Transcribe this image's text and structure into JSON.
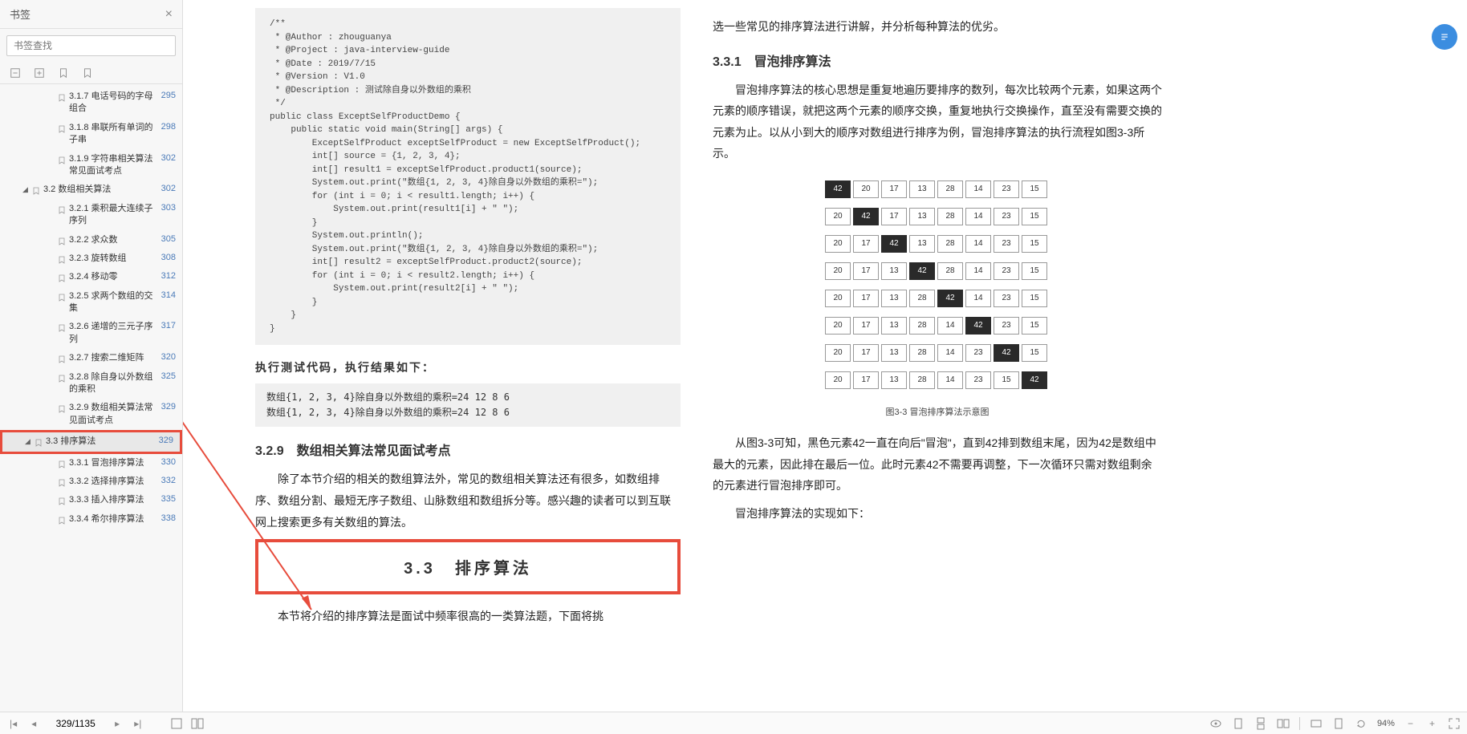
{
  "sidebar": {
    "title": "书签",
    "search_placeholder": "书签查找",
    "items": [
      {
        "label": "3.1.7  电话号码的字母组合",
        "page": "295",
        "indent": 2
      },
      {
        "label": "3.1.8  串联所有单词的子串",
        "page": "298",
        "indent": 2
      },
      {
        "label": "3.1.9  字符串相关算法常见面试考点",
        "page": "302",
        "indent": 2
      },
      {
        "label": "3.2  数组相关算法",
        "page": "302",
        "indent": 1,
        "expandable": true
      },
      {
        "label": "3.2.1  乘积最大连续子序列",
        "page": "303",
        "indent": 2
      },
      {
        "label": "3.2.2  求众数",
        "page": "305",
        "indent": 2
      },
      {
        "label": "3.2.3  旋转数组",
        "page": "308",
        "indent": 2
      },
      {
        "label": "3.2.4  移动零",
        "page": "312",
        "indent": 2
      },
      {
        "label": "3.2.5  求两个数组的交集",
        "page": "314",
        "indent": 2
      },
      {
        "label": "3.2.6  递增的三元子序列",
        "page": "317",
        "indent": 2
      },
      {
        "label": "3.2.7  搜索二维矩阵",
        "page": "320",
        "indent": 2
      },
      {
        "label": "3.2.8  除自身以外数组的乘积",
        "page": "325",
        "indent": 2
      },
      {
        "label": "3.2.9  数组相关算法常见面试考点",
        "page": "329",
        "indent": 2
      },
      {
        "label": "3.3  排序算法",
        "page": "329",
        "indent": 1,
        "active": true,
        "highlight": true,
        "expandable": true
      },
      {
        "label": "3.3.1  冒泡排序算法",
        "page": "330",
        "indent": 2
      },
      {
        "label": "3.3.2  选择排序算法",
        "page": "332",
        "indent": 2
      },
      {
        "label": "3.3.3  插入排序算法",
        "page": "335",
        "indent": 2
      },
      {
        "label": "3.3.4  希尔排序算法",
        "page": "338",
        "indent": 2
      }
    ]
  },
  "page_left": {
    "code": "/**\n * @Author : zhouguanya\n * @Project : java-interview-guide\n * @Date : 2019/7/15\n * @Version : V1.0\n * @Description : 测试除自身以外数组的乘积\n */\npublic class ExceptSelfProductDemo {\n    public static void main(String[] args) {\n        ExceptSelfProduct exceptSelfProduct = new ExceptSelfProduct();\n        int[] source = {1, 2, 3, 4};\n        int[] result1 = exceptSelfProduct.product1(source);\n        System.out.print(\"数组{1, 2, 3, 4}除自身以外数组的乘积=\");\n        for (int i = 0; i < result1.length; i++) {\n            System.out.print(result1[i] + \" \");\n        }\n        System.out.println();\n        System.out.print(\"数组{1, 2, 3, 4}除自身以外数组的乘积=\");\n        int[] result2 = exceptSelfProduct.product2(source);\n        for (int i = 0; i < result2.length; i++) {\n            System.out.print(result2[i] + \" \");\n        }\n    }\n}",
    "exec_label": "执行测试代码，执行结果如下：",
    "result": "数组{1, 2, 3, 4}除自身以外数组的乘积=24 12 8 6\n数组{1, 2, 3, 4}除自身以外数组的乘积=24 12 8 6",
    "heading_329": "3.2.9　数组相关算法常见面试考点",
    "para_329": "除了本节介绍的相关的数组算法外，常见的数组相关算法还有很多，如数组排序、数组分割、最短无序子数组、山脉数组和数组拆分等。感兴趣的读者可以到互联网上搜索更多有关数组的算法。",
    "heading_33": "3.3　排序算法",
    "para_33": "本节将介绍的排序算法是面试中频率很高的一类算法题，下面将挑"
  },
  "page_right": {
    "top_line": "选一些常见的排序算法进行讲解，并分析每种算法的优劣。",
    "heading_331": "3.3.1　冒泡排序算法",
    "para1": "冒泡排序算法的核心思想是重复地遍历要排序的数列，每次比较两个元素，如果这两个元素的顺序错误，就把这两个元素的顺序交换，重复地执行交换操作，直至没有需要交换的元素为止。以从小到大的顺序对数组进行排序为例，冒泡排序算法的执行流程如图3-3所示。",
    "diagram": {
      "values": [
        42,
        20,
        17,
        13,
        28,
        14,
        23,
        15
      ],
      "rows": [
        {
          "dark": 0,
          "vals": [
            42,
            20,
            17,
            13,
            28,
            14,
            23,
            15
          ]
        },
        {
          "dark": 1,
          "vals": [
            20,
            42,
            17,
            13,
            28,
            14,
            23,
            15
          ]
        },
        {
          "dark": 2,
          "vals": [
            20,
            17,
            42,
            13,
            28,
            14,
            23,
            15
          ]
        },
        {
          "dark": 3,
          "vals": [
            20,
            17,
            13,
            42,
            28,
            14,
            23,
            15
          ]
        },
        {
          "dark": 4,
          "vals": [
            20,
            17,
            13,
            28,
            42,
            14,
            23,
            15
          ]
        },
        {
          "dark": 5,
          "vals": [
            20,
            17,
            13,
            28,
            14,
            42,
            23,
            15
          ]
        },
        {
          "dark": 6,
          "vals": [
            20,
            17,
            13,
            28,
            14,
            23,
            42,
            15
          ]
        },
        {
          "dark": 7,
          "vals": [
            20,
            17,
            13,
            28,
            14,
            23,
            15,
            42
          ]
        }
      ],
      "caption": "图3-3  冒泡排序算法示意图"
    },
    "para2": "从图3-3可知，黑色元素42一直在向后\"冒泡\"，直到42排到数组末尾，因为42是数组中最大的元素，因此排在最后一位。此时元素42不需要再调整，下一次循环只需对数组剩余的元素进行冒泡排序即可。",
    "para3": "冒泡排序算法的实现如下："
  },
  "bottom": {
    "page_display": "329/1135",
    "zoom": "94%"
  }
}
